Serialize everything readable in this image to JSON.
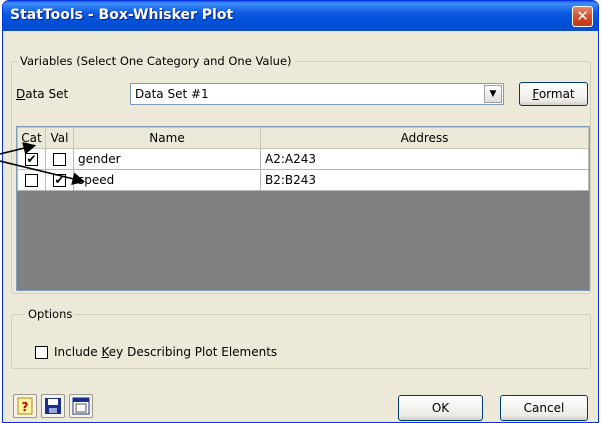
{
  "window": {
    "title": "StatTools - Box-Whisker Plot",
    "close_glyph": "✕"
  },
  "variables": {
    "legend": "Variables (Select One Category and One Value)",
    "data_set_label_accel": "D",
    "data_set_label_rest": "ata Set",
    "data_set_value": "Data Set #1",
    "format_accel": "F",
    "format_rest": "ormat",
    "columns": [
      "Cat",
      "Val",
      "Name",
      "Address"
    ],
    "rows": [
      {
        "cat": true,
        "val": false,
        "name": "gender",
        "address": "A2:A243"
      },
      {
        "cat": false,
        "val": true,
        "name": "speed",
        "address": "B2:B243"
      }
    ]
  },
  "options": {
    "legend": "Options",
    "include_key_pre": "Include ",
    "include_key_accel": "K",
    "include_key_post": "ey Describing Plot Elements",
    "include_key_checked": false
  },
  "footer": {
    "ok_label": "OK",
    "cancel_label": "Cancel",
    "icons": [
      "help-icon",
      "save-icon",
      "window-icon"
    ]
  },
  "colors": {
    "title_bar": "#0050d8",
    "grid_empty": "#808080",
    "check": "#21a121"
  }
}
